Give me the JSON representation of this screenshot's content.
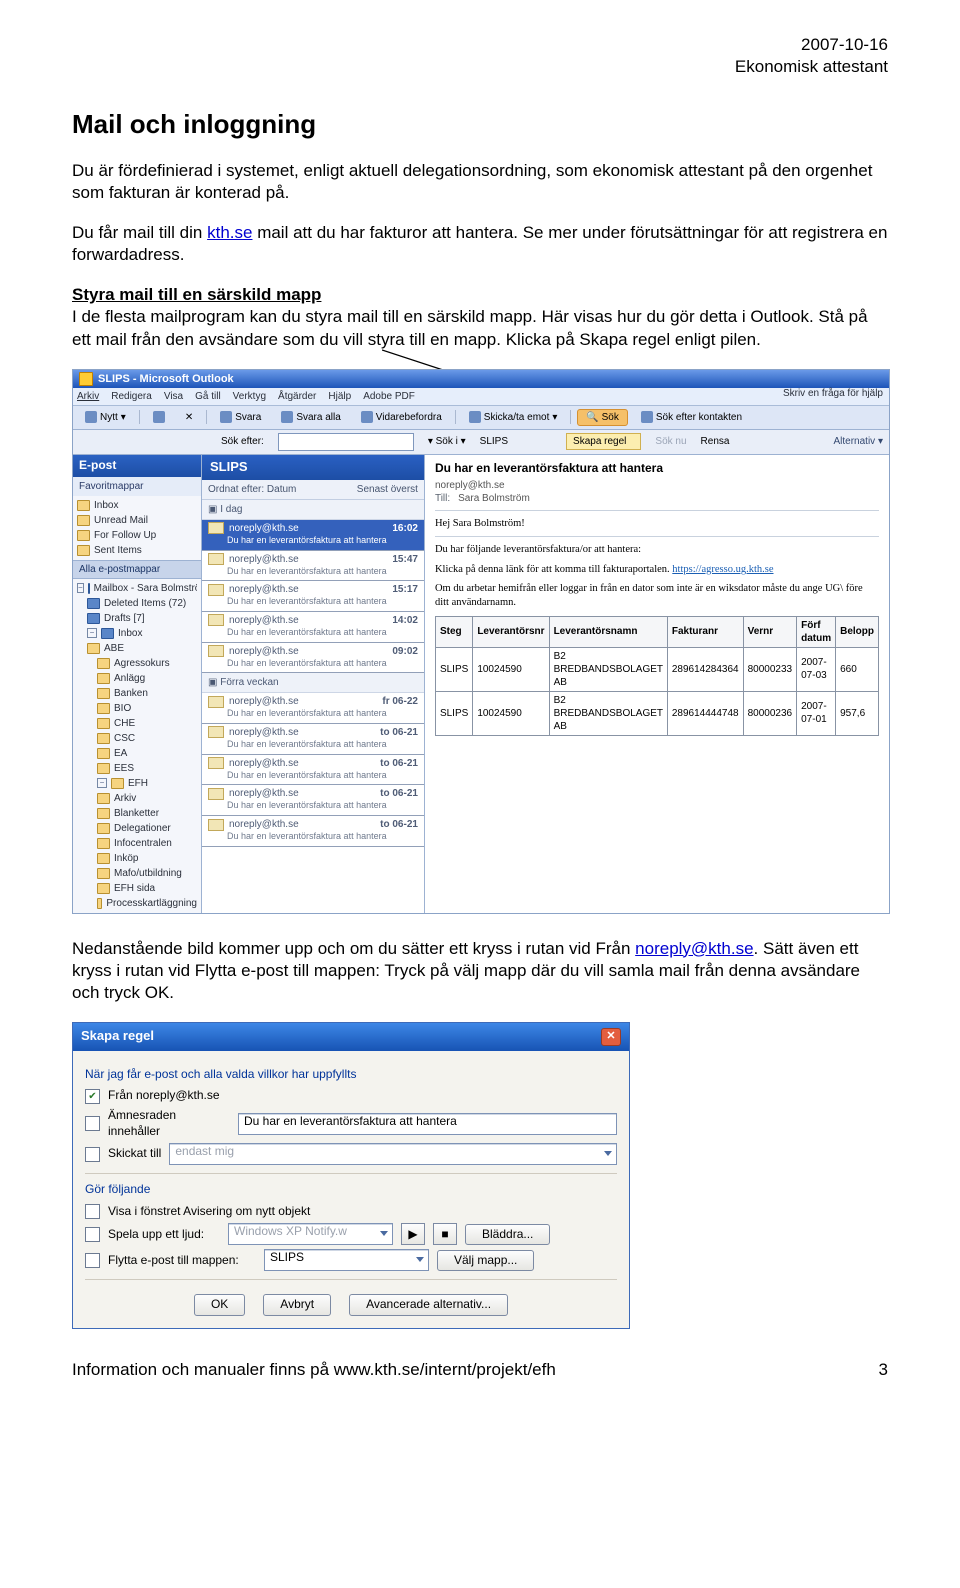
{
  "header": {
    "date": "2007-10-16",
    "doc": "Ekonomisk attestant"
  },
  "title": "Mail och inloggning",
  "para1": "Du är fördefinierad i systemet, enligt aktuell delegationsordning, som ekonomisk attestant på den orgenhet som fakturan är konterad på.",
  "para2a": "Du får mail till din ",
  "para2link": "kth.se",
  "para2b": " mail att du har fakturor att hantera. Se mer under förutsättningar för att registrera en forwardadress.",
  "h3": "Styra mail till en särskild mapp",
  "para3": "I de flesta mailprogram kan du styra mail till en särskild mapp. Här visas hur du gör detta i Outlook. Stå på ett mail från den avsändare som du vill styra till en mapp. Klicka på Skapa regel enligt pilen.",
  "outlook": {
    "title": "SLIPS - Microsoft Outlook",
    "menu": [
      "Arkiv",
      "Redigera",
      "Visa",
      "Gå till",
      "Verktyg",
      "Åtgärder",
      "Hjälp",
      "Adobe PDF"
    ],
    "searchhelp": "Skriv en fråga för hjälp",
    "tb": {
      "nytt": "Nytt",
      "svara": "Svara",
      "svaraalla": "Svara alla",
      "vidare": "Vidarebefordra",
      "skicka": "Skicka/ta emot",
      "sok": "Sök",
      "kontakt": "Sök efter kontakten"
    },
    "topsearch": {
      "lab": "Sök efter:",
      "soki": "Sök i",
      "slips": "SLIPS",
      "skapa": "Skapa regel",
      "soknu": "Sök nu",
      "rensa": "Rensa",
      "alt": "Alternativ"
    },
    "side": {
      "head": "E-post",
      "fav": "Favoritmappar",
      "items": [
        "Inbox",
        "Unread Mail",
        "For Follow Up",
        "Sent Items"
      ],
      "all": "Alla e-postmappar",
      "tree": [
        "Mailbox - Sara Bolmström",
        "Deleted Items (72)",
        "Drafts [7]",
        "Inbox",
        "ABE",
        "Agressokurs",
        "Anlägg",
        "Banken",
        "BIO",
        "CHE",
        "CSC",
        "EA",
        "EES",
        "EFH",
        "Arkiv",
        "Blanketter",
        "Delegationer",
        "Infocentralen",
        "Inköp",
        "Mafo/utbildning",
        "EFH sida",
        "Processkartläggning"
      ]
    },
    "mid": {
      "blue": "SLIPS",
      "grp_l": "Ordnat efter: Datum",
      "grp_r": "Senast överst",
      "day1": "I dag",
      "day2": "Förra veckan",
      "msgs": [
        {
          "from": "noreply@kth.se",
          "time": "16:02",
          "subj": "Du har en leverantörsfaktura att hantera",
          "sel": true
        },
        {
          "from": "noreply@kth.se",
          "time": "15:47",
          "subj": "Du har en leverantörsfaktura att hantera"
        },
        {
          "from": "noreply@kth.se",
          "time": "15:17",
          "subj": "Du har en leverantörsfaktura att hantera"
        },
        {
          "from": "noreply@kth.se",
          "time": "14:02",
          "subj": "Du har en leverantörsfaktura att hantera"
        },
        {
          "from": "noreply@kth.se",
          "time": "09:02",
          "subj": "Du har en leverantörsfaktura att hantera"
        }
      ],
      "msgs2": [
        {
          "from": "noreply@kth.se",
          "time": "fr 06-22",
          "subj": "Du har en leverantörsfaktura att hantera"
        },
        {
          "from": "noreply@kth.se",
          "time": "to 06-21",
          "subj": "Du har en leverantörsfaktura att hantera"
        },
        {
          "from": "noreply@kth.se",
          "time": "to 06-21",
          "subj": "Du har en leverantörsfaktura att hantera"
        },
        {
          "from": "noreply@kth.se",
          "time": "to 06-21",
          "subj": "Du har en leverantörsfaktura att hantera"
        },
        {
          "from": "noreply@kth.se",
          "time": "to 06-21",
          "subj": "Du har en leverantörsfaktura att hantera"
        }
      ]
    },
    "read": {
      "subject": "Du har en leverantörsfaktura att hantera",
      "from": "noreply@kth.se",
      "to_lab": "Till:",
      "to": "Sara Bolmström",
      "greet": "Hej Sara Bolmström!",
      "p1": "Du har följande leverantörsfaktura/or att hantera:",
      "p2a": "Klicka på denna länk för att komma till fakturaportalen. ",
      "p2link": "https://agresso.ug.kth.se",
      "p3": "Om du arbetar hemifrån eller loggar in från en dator som inte är en wiksdator måste du ange UG\\ före ditt användarnamn.",
      "th": [
        "Steg",
        "Leverantörsnr",
        "Leverantörsnamn",
        "Fakturanr",
        "Vernr",
        "Förf datum",
        "Belopp"
      ],
      "rows": [
        [
          "SLIPS",
          "10024590",
          "B2 BREDBANDSBOLAGET AB",
          "289614284364",
          "80000233",
          "2007-07-03",
          "660"
        ],
        [
          "SLIPS",
          "10024590",
          "B2 BREDBANDSBOLAGET AB",
          "289614444748",
          "80000236",
          "2007-07-01",
          "957,6"
        ]
      ]
    }
  },
  "para4a": "Nedanstående bild kommer upp och om du sätter ett kryss i rutan vid Från ",
  "para4link": "noreply@kth.se",
  "para4b": ". Sätt även ett kryss i rutan vid Flytta e-post till mappen: Tryck på välj mapp där du vill samla mail från denna avsändare och tryck OK.",
  "dlg": {
    "title": "Skapa regel",
    "sec1": "När jag får e-post och alla valda villkor har uppfyllts",
    "from": "Från noreply@kth.se",
    "amne": "Ämnesraden innehåller",
    "amne_v": "Du har en leverantörsfaktura att hantera",
    "skick": "Skickat till",
    "skick_v": "endast mig",
    "sec2": "Gör följande",
    "avis": "Visa i fönstret Avisering om nytt objekt",
    "ljud": "Spela upp ett ljud:",
    "ljud_v": "Windows XP Notify.w",
    "bladd": "Bläddra...",
    "flytt": "Flytta e-post till mappen:",
    "flytt_v": "SLIPS",
    "valj": "Välj mapp...",
    "ok": "OK",
    "avbryt": "Avbryt",
    "avanc": "Avancerade alternativ..."
  },
  "footer": {
    "left": "Information och manualer finns på www.kth.se/internt/projekt/efh",
    "page": "3"
  }
}
